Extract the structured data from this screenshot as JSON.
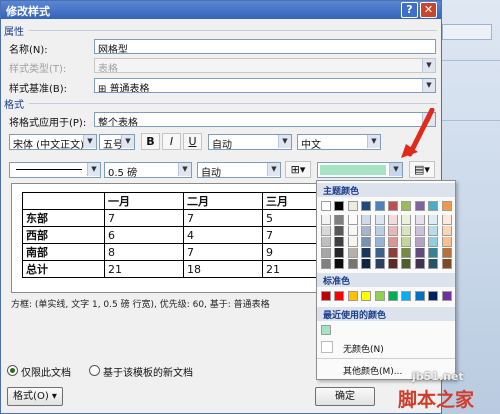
{
  "window": {
    "title": "修改样式",
    "help": "?",
    "close": "✕"
  },
  "properties": {
    "section": "属性",
    "name_label": "名称(N):",
    "name_value": "网格型",
    "type_label": "样式类型(T):",
    "type_value": "表格",
    "base_label": "样式基准(B):",
    "base_value": "普通表格"
  },
  "format": {
    "section": "格式",
    "apply_label": "将格式应用于(P):",
    "apply_value": "整个表格",
    "font": "宋体 (中文正文)",
    "size": "五号",
    "bold": "B",
    "italic": "I",
    "underline": "U",
    "font_color": "自动",
    "language": "中文",
    "line_weight": "0.5 磅",
    "border_color": "自动",
    "shading_color": "#a6e4c3"
  },
  "preview_table": {
    "header": [
      "",
      "一月",
      "二月",
      "三月"
    ],
    "rows": [
      [
        "东部",
        "7",
        "7",
        "5"
      ],
      [
        "西部",
        "6",
        "4",
        "7"
      ],
      [
        "南部",
        "8",
        "7",
        "9"
      ],
      [
        "总计",
        "21",
        "18",
        "21"
      ]
    ]
  },
  "description": "方框: (单实线, 文字 1, 0.5 磅 行宽), 优先级: 60, 基于: 普通表格",
  "bottom": {
    "radio_this_doc": "仅限此文档",
    "radio_template": "基于该模板的新文档",
    "format_button": "格式(O)",
    "ok_button": "确定"
  },
  "palette": {
    "theme_title": "主题颜色",
    "standard_title": "标准色",
    "recent_title": "最近使用的颜色",
    "no_color": "无颜色(N)",
    "more_colors": "其他颜色(M)...",
    "theme_top": [
      "#ffffff",
      "#000000",
      "#eeece1",
      "#1f497d",
      "#4f81bd",
      "#c0504d",
      "#9bbb59",
      "#8064a2",
      "#4bacc6",
      "#f79646"
    ],
    "standard": [
      "#c00000",
      "#ff0000",
      "#ffc000",
      "#ffff00",
      "#92d050",
      "#00b050",
      "#00b0f0",
      "#0070c0",
      "#002060",
      "#7030a0"
    ],
    "recent": [
      "#a6e4c3"
    ]
  },
  "watermark": {
    "line1": "jb51.net",
    "line2": "脚本之家"
  }
}
